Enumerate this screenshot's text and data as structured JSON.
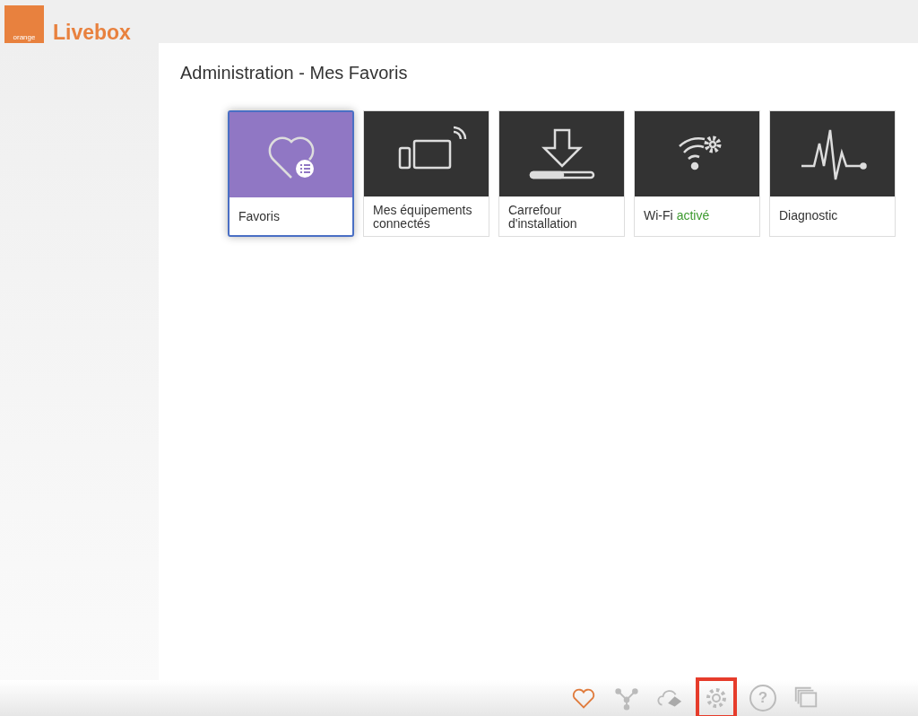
{
  "logo": {
    "badge": "orange",
    "name": "Livebox"
  },
  "page_title": "Administration - Mes Favoris",
  "tiles": [
    {
      "kind": "favorites",
      "label": "Favoris",
      "selected": true
    },
    {
      "kind": "devices",
      "label": "Mes équipements connectés",
      "selected": false
    },
    {
      "kind": "install",
      "label": "Carrefour d'installation",
      "selected": false
    },
    {
      "kind": "wifi",
      "label": "Wi-Fi",
      "status": "activé",
      "selected": false
    },
    {
      "kind": "diagnostic",
      "label": "Diagnostic",
      "selected": false
    }
  ],
  "dock": [
    {
      "kind": "heart",
      "selected": true,
      "highlighted": false
    },
    {
      "kind": "network",
      "selected": false,
      "highlighted": false
    },
    {
      "kind": "cloud",
      "selected": false,
      "highlighted": false
    },
    {
      "kind": "gear",
      "selected": false,
      "highlighted": true
    },
    {
      "kind": "help",
      "symbol": "?",
      "selected": false,
      "highlighted": false
    },
    {
      "kind": "windows",
      "selected": false,
      "highlighted": false
    }
  ]
}
